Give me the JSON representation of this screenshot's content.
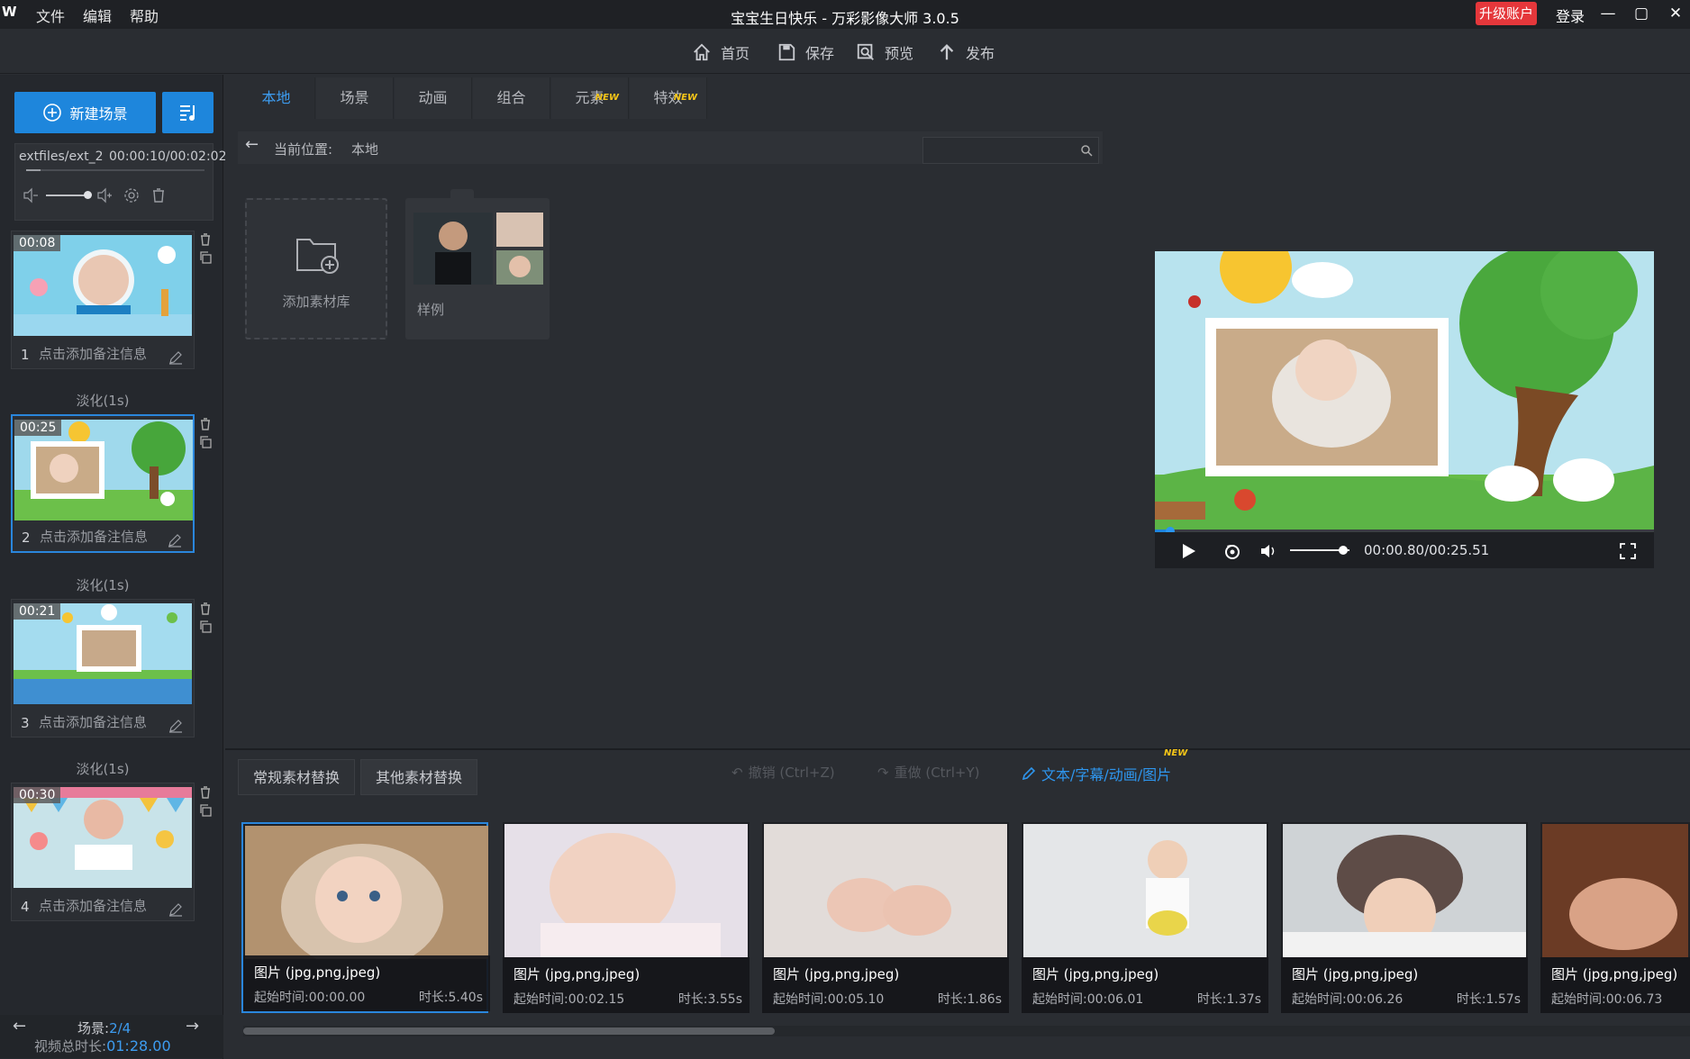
{
  "titlebar": {
    "logo": "W",
    "menu": [
      "文件",
      "编辑",
      "帮助"
    ],
    "title": "宝宝生日快乐 - 万彩影像大师 3.0.5",
    "upgrade": "升级账户",
    "login": "登录"
  },
  "toolbar": {
    "home": "首页",
    "save": "保存",
    "preview": "预览",
    "publish": "发布"
  },
  "left": {
    "new_scene": "新建场景",
    "audio": {
      "path": "extfiles/ext_2",
      "time": "00:00:10/00:02:02",
      "progress": 0.08
    },
    "scenes": [
      {
        "num": "1",
        "dur": "00:08",
        "note": "点击添加备注信息"
      },
      {
        "num": "2",
        "dur": "00:25",
        "note": "点击添加备注信息"
      },
      {
        "num": "3",
        "dur": "00:21",
        "note": "点击添加备注信息"
      },
      {
        "num": "4",
        "dur": "00:30",
        "note": "点击添加备注信息"
      }
    ],
    "transition": "淡化(1s)",
    "nav": {
      "scene_label": "场景:",
      "scene_value": "2/4",
      "total_label": "视频总时长:",
      "total_value": "01:28.00"
    }
  },
  "library": {
    "tabs": [
      {
        "label": "本地"
      },
      {
        "label": "场景"
      },
      {
        "label": "动画"
      },
      {
        "label": "组合"
      },
      {
        "label": "元素",
        "badge": "NEW"
      },
      {
        "label": "特效",
        "badge": "NEW"
      }
    ],
    "location_label": "当前位置:",
    "location_value": "本地",
    "add_library": "添加素材库",
    "sample": "样例"
  },
  "preview": {
    "time": "00:00.80/00:25.51",
    "progress": 0.031,
    "volume": 0.9
  },
  "bottom": {
    "tab1": "常规素材替换",
    "tab2": "其他素材替换",
    "undo": "撤销 (Ctrl+Z)",
    "redo": "重做 (Ctrl+Y)",
    "text_link": "文本/字幕/动画/图片",
    "text_badge": "NEW",
    "cards": [
      {
        "type": "图片 (jpg,png,jpeg)",
        "start": "起始时间:00:00.00",
        "dur": "时长:5.40s"
      },
      {
        "type": "图片 (jpg,png,jpeg)",
        "start": "起始时间:00:02.15",
        "dur": "时长:3.55s"
      },
      {
        "type": "图片 (jpg,png,jpeg)",
        "start": "起始时间:00:05.10",
        "dur": "时长:1.86s"
      },
      {
        "type": "图片 (jpg,png,jpeg)",
        "start": "起始时间:00:06.01",
        "dur": "时长:1.37s"
      },
      {
        "type": "图片 (jpg,png,jpeg)",
        "start": "起始时间:00:06.26",
        "dur": "时长:1.57s"
      },
      {
        "type": "图片 (jpg,png,jpeg)",
        "start": "起始时间:00:06.73",
        "dur": ""
      }
    ]
  },
  "colors": {
    "accent": "#1e86dc",
    "upgrade": "#e5373b",
    "badge": "#f5c518"
  }
}
